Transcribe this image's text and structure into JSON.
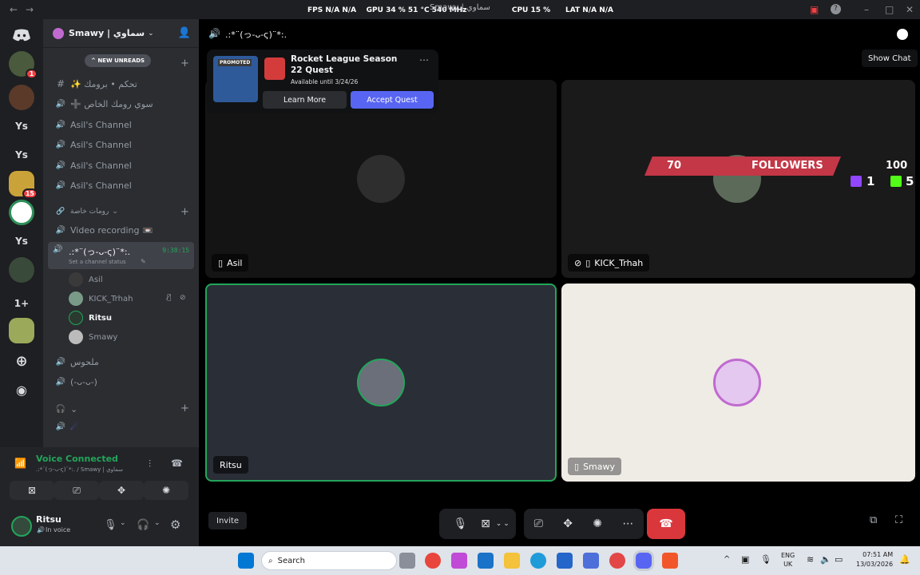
{
  "titlebar": {
    "overlay": {
      "fps_label": "FPS",
      "fps_value": "N/A",
      "fps_value2": "N/A",
      "gpu_label": "GPU",
      "gpu_value": "34 %  51 °C  540 MHz",
      "cpu_label": "CPU",
      "cpu_value": "15 %",
      "lat_label": "LAT",
      "lat_value": "N/A",
      "lat_value2": "N/A"
    },
    "window_title": "Smawy | سماوي"
  },
  "servers": {
    "items": [
      {
        "label": "",
        "badge": ""
      },
      {
        "label": "",
        "badge": "1"
      },
      {
        "label": "",
        "badge": ""
      },
      {
        "label": "Ys",
        "badge": ""
      },
      {
        "label": "Ys",
        "badge": ""
      },
      {
        "label": "",
        "badge": "15"
      },
      {
        "label": "",
        "badge": ""
      },
      {
        "label": "Ys",
        "badge": ""
      },
      {
        "label": "",
        "badge": ""
      },
      {
        "label": "1+",
        "badge": ""
      },
      {
        "label": "",
        "badge": ""
      }
    ]
  },
  "guild": {
    "name": "Smawy | سماوي",
    "new_unreads": "NEW UNREADS",
    "channels": [
      {
        "icon": "#",
        "label": "✨ تحكم • برومك"
      },
      {
        "icon": "🔊",
        "label": "➕ سوي رومك الخاص"
      },
      {
        "icon": "🔊",
        "label": "Asil's Channel"
      },
      {
        "icon": "🔊",
        "label": "Asil's Channel"
      },
      {
        "icon": "🔊",
        "label": "Asil's Channel"
      },
      {
        "icon": "🔊",
        "label": "Asil's Channel"
      }
    ],
    "category2": "رومات خاصة",
    "video_recording": "Video recording 📼",
    "active_channel": {
      "name": ".:*¨(っ-ᴗ-ς)¨*:.",
      "timer": "9:38:15",
      "status_hint": "Set a channel status"
    },
    "members": [
      "Asil",
      "KICK_Trhah",
      "Ritsu",
      "Smawy"
    ],
    "more_channels": [
      "ملحوس",
      "(-ᴗ-ᴗ-)"
    ]
  },
  "voice_panel": {
    "title": "Voice Connected",
    "subtitle": ".:*¨(っ-ᴗ-ς)¨*:. / Smawy | سماوي",
    "username": "Ritsu",
    "status": "In voice"
  },
  "stage": {
    "channel_title": ".:*¨(っ-ᴗ-ς)¨*:.",
    "show_chat_tooltip": "Show Chat",
    "quest": {
      "promoted": "PROMOTED",
      "title": "Rocket League Season 22 Quest",
      "subtitle": "Available until 3/24/26",
      "learn_more": "Learn More",
      "accept": "Accept Quest"
    },
    "tiles": [
      {
        "name": "Asil"
      },
      {
        "name": "KICK_Trhah"
      },
      {
        "name": "Ritsu"
      },
      {
        "name": "Smawy"
      }
    ],
    "overlay_banner": {
      "left_num": "70",
      "label": "FOLLOWERS",
      "right_num": "100",
      "twitch_count": "1",
      "kick_count": "5"
    },
    "invite": "Invite"
  },
  "taskbar": {
    "search": "Search",
    "lang1": "ENG",
    "lang2": "UK",
    "time": "07:51 AM",
    "date": "13/03/2026"
  },
  "colors": {
    "accent": "#5865f2",
    "green": "#23a55a",
    "red": "#da373c"
  }
}
